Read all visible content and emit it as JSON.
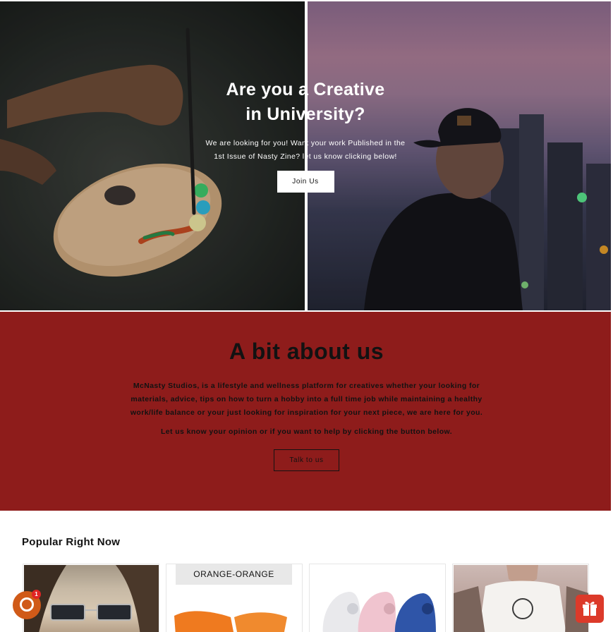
{
  "hero": {
    "title_line1": "Are you a Creative",
    "title_line2": "in University?",
    "text": "We are looking for you! Want your work Published in the 1st Issue of Nasty Zine? let us know clicking below!",
    "button_label": "Join Us"
  },
  "about": {
    "title": "A bit about us",
    "text": "McNasty Studios, is a lifestyle and wellness platform for creatives whether your looking for materials, advice, tips on how to turn a hobby into a full time job while maintaining a healthy work/life balance or your just looking for inspiration for your next piece, we are here for you.",
    "text2": "Let us know your opinion or if you want to help by clicking the button below.",
    "button_label": "Talk to us",
    "background_color": "#8e1c1b"
  },
  "popular": {
    "title": "Popular Right Now",
    "products": [
      {
        "badge": ""
      },
      {
        "badge": "ORANGE-ORANGE"
      },
      {
        "badge": ""
      },
      {
        "badge": ""
      }
    ]
  },
  "widgets": {
    "chat_count": "1",
    "chat_icon": "chat-bubble-icon",
    "gift_icon": "gift-icon"
  }
}
